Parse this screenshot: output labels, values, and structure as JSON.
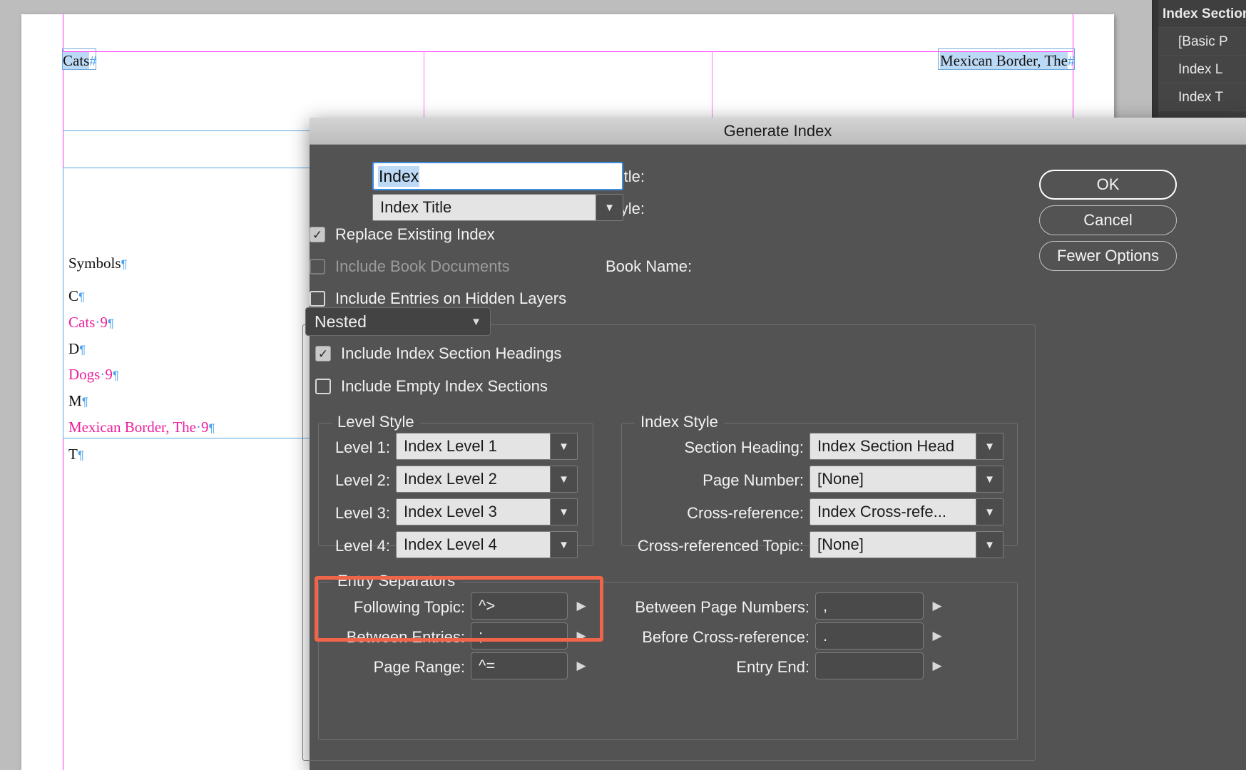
{
  "document": {
    "frames": [
      {
        "text": "Cats",
        "marker": "#"
      },
      {
        "text": "Mexican Border, The",
        "marker": "#"
      }
    ],
    "index_entries": [
      {
        "text": "Symbols",
        "color": "black",
        "pilcrow": true
      },
      {
        "text": "C",
        "color": "black",
        "pilcrow": true
      },
      {
        "text": "Cats",
        "page": "9",
        "color": "magenta",
        "pilcrow": true
      },
      {
        "text": "D",
        "color": "black",
        "pilcrow": true
      },
      {
        "text": "Dogs",
        "page": "9",
        "color": "magenta",
        "pilcrow": true
      },
      {
        "text": "M",
        "color": "black",
        "pilcrow": true
      },
      {
        "text": "Mexican Border, The",
        "page": "9",
        "color": "magenta",
        "pilcrow": true
      },
      {
        "text": "T",
        "color": "black",
        "pilcrow": true
      }
    ]
  },
  "dock": {
    "rows": [
      {
        "label": "Index Section",
        "type": "header"
      },
      {
        "label": "[Basic P",
        "type": "item"
      },
      {
        "label": "Index L",
        "type": "item"
      },
      {
        "label": "Index T",
        "type": "item"
      }
    ]
  },
  "dialog": {
    "title": "Generate Index",
    "title_field": {
      "label": "Title:",
      "value": "Index",
      "selected": true
    },
    "title_style": {
      "label": "Title Style:",
      "value": "Index Title"
    },
    "checkboxes": {
      "replace_existing": {
        "label": "Replace Existing Index",
        "checked": true,
        "disabled": false
      },
      "include_book_documents": {
        "label": "Include Book Documents",
        "checked": false,
        "disabled": true
      },
      "include_hidden_layers": {
        "label": "Include Entries on Hidden Layers",
        "checked": false,
        "disabled": false
      },
      "include_section_headings": {
        "label": "Include Index Section Headings",
        "checked": true,
        "disabled": false
      },
      "include_empty_sections": {
        "label": "Include Empty Index Sections",
        "checked": false,
        "disabled": false
      }
    },
    "book_name_label": "Book Name:",
    "format_select": {
      "value": "Nested"
    },
    "buttons": {
      "ok": "OK",
      "cancel": "Cancel",
      "fewer_options": "Fewer Options"
    },
    "level_style": {
      "title": "Level Style",
      "rows": [
        {
          "label": "Level 1:",
          "value": "Index Level 1"
        },
        {
          "label": "Level 2:",
          "value": "Index Level 2"
        },
        {
          "label": "Level 3:",
          "value": "Index Level 3"
        },
        {
          "label": "Level 4:",
          "value": "Index Level 4"
        }
      ]
    },
    "index_style": {
      "title": "Index Style",
      "rows": [
        {
          "label": "Section Heading:",
          "value": "Index Section Head"
        },
        {
          "label": "Page Number:",
          "value": "[None]"
        },
        {
          "label": "Cross-reference:",
          "value": "Index Cross-refe..."
        },
        {
          "label": "Cross-referenced Topic:",
          "value": "[None]"
        }
      ]
    },
    "entry_separators": {
      "title": "Entry Separators",
      "left_rows": [
        {
          "label": "Following Topic:",
          "value": "^>"
        },
        {
          "label": "Between Entries:",
          "value": ";"
        },
        {
          "label": "Page Range:",
          "value": "^="
        }
      ],
      "right_rows": [
        {
          "label": "Between Page Numbers:",
          "value": ","
        },
        {
          "label": "Before Cross-reference:",
          "value": "."
        },
        {
          "label": "Entry End:",
          "value": ""
        }
      ],
      "highlight_color": "#f0654a"
    }
  }
}
